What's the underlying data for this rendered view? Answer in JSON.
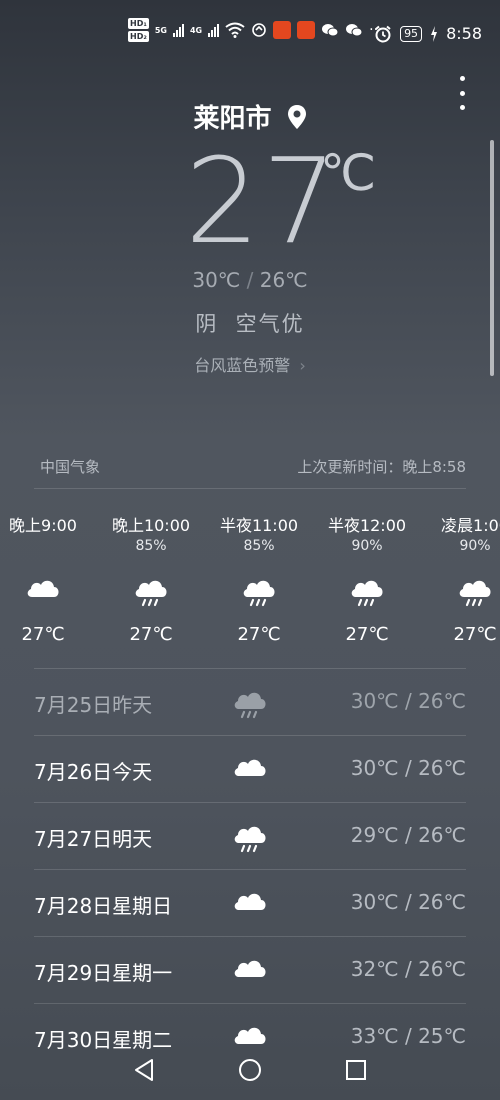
{
  "status_bar": {
    "hd1": "HD₁",
    "hd2": "HD₂",
    "net1": "5G",
    "net2": "4G",
    "battery": "95",
    "time": "8:58",
    "more": "···",
    "icons": [
      "signal-icon",
      "wifi-icon",
      "app-badge-icon",
      "wechat-icon",
      "alarm-icon",
      "charging-icon"
    ]
  },
  "location": {
    "city": "莱阳市"
  },
  "current": {
    "temp": "27",
    "unit": "℃",
    "high": "30℃",
    "separator": "/",
    "low": "26℃",
    "condition": "阴  空气优",
    "alert": "台风蓝色预警",
    "alert_chevron": "›"
  },
  "source": {
    "provider": "中国气象",
    "update": "上次更新时间：晚上8:58"
  },
  "hourly": [
    {
      "time": "晚上9:00",
      "rain": "",
      "icon": "cloudy-icon",
      "temp": "27℃"
    },
    {
      "time": "晚上10:00",
      "rain": "85%",
      "icon": "rain-icon",
      "temp": "27℃"
    },
    {
      "time": "半夜11:00",
      "rain": "85%",
      "icon": "rain-icon",
      "temp": "27℃"
    },
    {
      "time": "半夜12:00",
      "rain": "90%",
      "icon": "rain-icon",
      "temp": "27℃"
    },
    {
      "time": "凌晨1:00",
      "rain": "90%",
      "icon": "rain-icon",
      "temp": "27℃"
    }
  ],
  "daily": [
    {
      "date": "7月25日昨天",
      "icon": "rain-icon",
      "temp": "30℃ / 26℃",
      "past": true
    },
    {
      "date": "7月26日今天",
      "icon": "cloudy-icon",
      "temp": "30℃ / 26℃",
      "past": false
    },
    {
      "date": "7月27日明天",
      "icon": "rain-icon",
      "temp": "29℃ / 26℃",
      "past": false
    },
    {
      "date": "7月28日星期日",
      "icon": "cloudy-icon",
      "temp": "30℃ / 26℃",
      "past": false
    },
    {
      "date": "7月29日星期一",
      "icon": "cloudy-icon",
      "temp": "32℃ / 26℃",
      "past": false
    },
    {
      "date": "7月30日星期二",
      "icon": "cloudy-icon",
      "temp": "33℃ / 25℃",
      "past": false
    }
  ],
  "colors": {
    "background_top": "#2f343c",
    "background_mid": "#50565f",
    "accent_text": "#ffffff",
    "muted_text": "#b6bbc2"
  },
  "nav": {
    "icons": [
      "back-icon",
      "home-icon",
      "recents-icon"
    ]
  }
}
